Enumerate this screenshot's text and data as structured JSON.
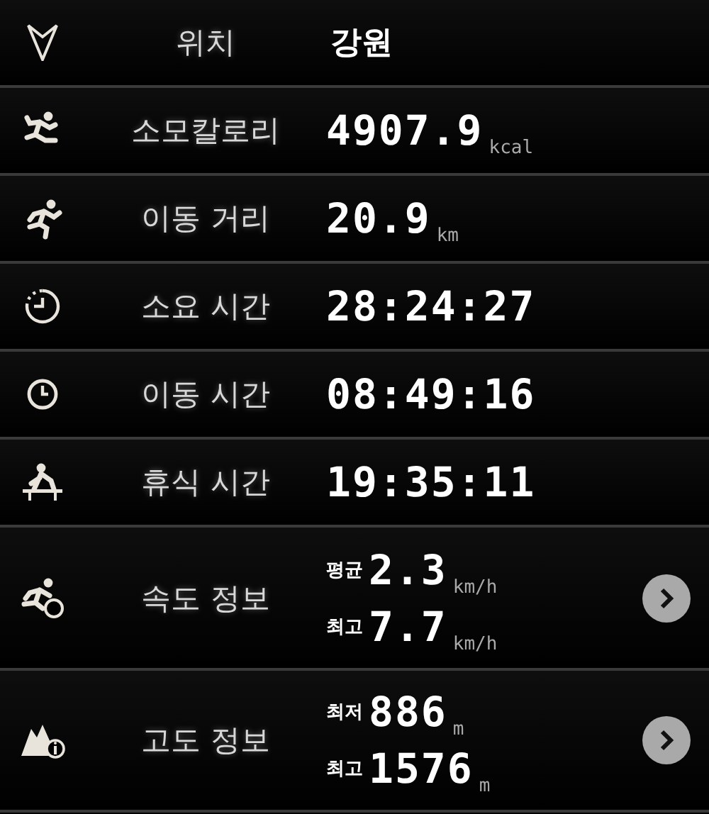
{
  "rows": [
    {
      "kind": "location",
      "label": "위치",
      "value": "강원"
    },
    {
      "kind": "simple",
      "label": "소모칼로리",
      "value": "4907.9",
      "unit": "kcal"
    },
    {
      "kind": "simple",
      "label": "이동 거리",
      "value": "20.9",
      "unit": "km"
    },
    {
      "kind": "simple",
      "label": "소요 시간",
      "value": "28:24:27"
    },
    {
      "kind": "simple",
      "label": "이동 시간",
      "value": "08:49:16"
    },
    {
      "kind": "simple",
      "label": "휴식 시간",
      "value": "19:35:11"
    },
    {
      "kind": "detail",
      "label": "속도 정보",
      "lines": [
        {
          "label": "평균",
          "value": "2.3",
          "unit": "km/h"
        },
        {
          "label": "최고",
          "value": "7.7",
          "unit": "km/h"
        }
      ]
    },
    {
      "kind": "detail",
      "label": "고도 정보",
      "lines": [
        {
          "label": "최저",
          "value": "886",
          "unit": "m"
        },
        {
          "label": "최고",
          "value": "1576",
          "unit": "m"
        }
      ]
    }
  ]
}
